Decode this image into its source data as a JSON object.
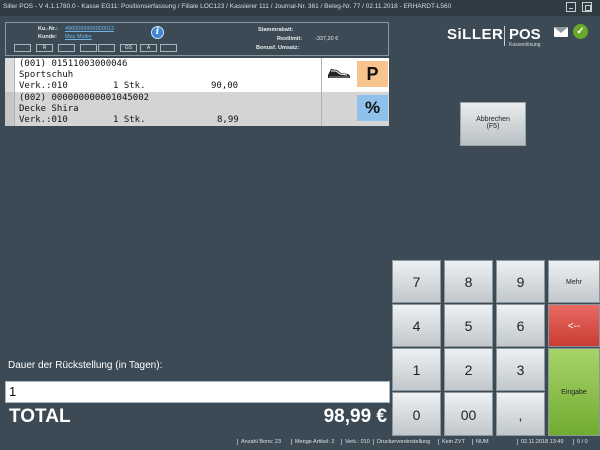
{
  "window": {
    "title": "Siller POS - V 4.1.1780.0 - Kasse EG11: Positionserfassung / Filiale LOC123 / Kassierer 111 / Journal-Nr. 361 / Beleg-Nr. 77 / 02.11.2018  -  ERHARDT-L560"
  },
  "customer": {
    "kunr_label": "Ku.-Nr.:",
    "kunr_value": "4960099900000013",
    "kunde_label": "Kunde:",
    "kunde_value": "Max Müller",
    "buttons": [
      "",
      "R",
      "",
      "",
      "",
      "GS",
      "A",
      ""
    ],
    "stammrabatt_label": "Stammrabatt:",
    "restlimit_label": "Restlimit:",
    "restlimit_value": "-337,20 €",
    "bonusumsatz_label": "Bonusf. Umsatz:"
  },
  "logo": {
    "brand": "SiLLER",
    "product": "POS",
    "subtitle": "Kassenlösung"
  },
  "items": [
    {
      "line1": "(001) 01511003000046",
      "line2": "Sportschuh",
      "verk": "Verk.:010",
      "qty": "1 Stk.",
      "price": "90,00",
      "badge": "P"
    },
    {
      "line1": "(002) 000000000001045002",
      "line2": "Decke Shira",
      "verk": "Verk.:010",
      "qty": "1 Stk.",
      "price": "8,99",
      "badge": "%"
    }
  ],
  "cancel_button": {
    "line1": "Abbrechen",
    "line2": "(F5)"
  },
  "keypad": {
    "k7": "7",
    "k8": "8",
    "k9": "9",
    "mehr": "Mehr",
    "k4": "4",
    "k5": "5",
    "k6": "6",
    "back": "<--",
    "k1": "1",
    "k2": "2",
    "k3": "3",
    "enter": "Eingabe",
    "k0": "0",
    "k00": "00",
    "comma": ","
  },
  "prompt": "Dauer der Rückstellung (in Tagen):",
  "input_value": "1",
  "total": {
    "label": "TOTAL",
    "value": "98,99 €"
  },
  "statusbar": [
    "Anzahl Bons: 23",
    "Menge Artikel: 2",
    "Verk.: 010",
    "Druckervoreinstellung",
    "Kein ZVT",
    "NUM",
    "",
    "02.11.2018 13:49",
    "0 / 0"
  ]
}
